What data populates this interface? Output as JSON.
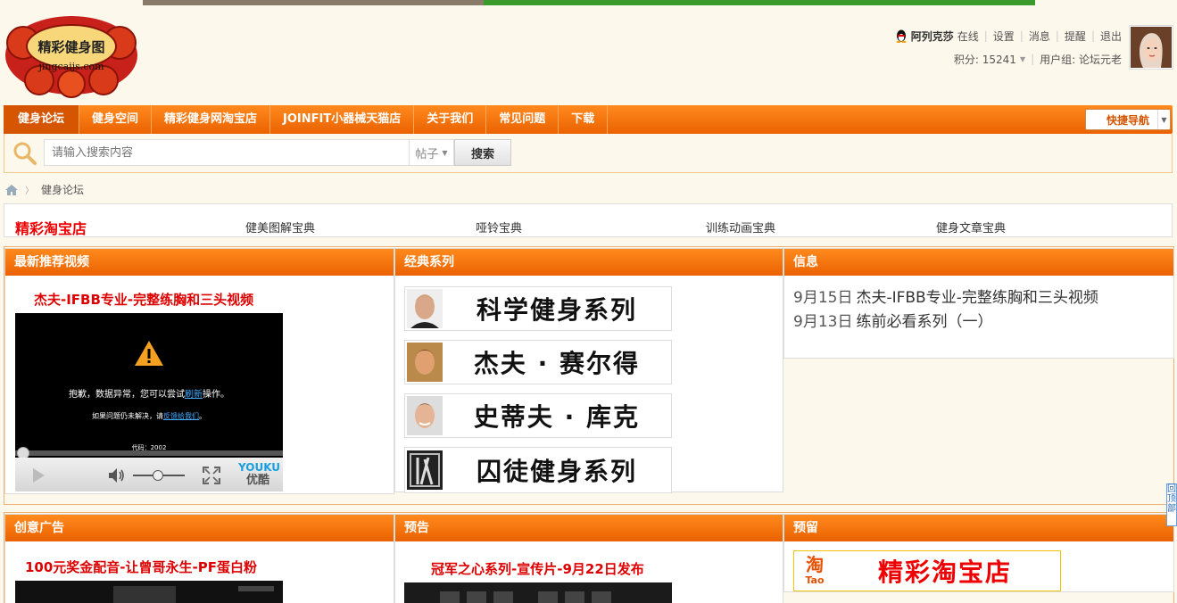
{
  "logo": {
    "site_text": "jingcaijs.com",
    "name_chars": "精彩健身图"
  },
  "user": {
    "name": "阿列克莎",
    "status": "在线",
    "links": [
      "设置",
      "消息",
      "提醒",
      "退出"
    ],
    "points_label": "积分: 15241",
    "group_label": "用户组: 论坛元老"
  },
  "nav": {
    "items": [
      "健身论坛",
      "健身空间",
      "精彩健身网淘宝店",
      "JOINFIT小器械天猫店",
      "关于我们",
      "常见问题",
      "下载"
    ],
    "quick_nav": "快捷导航"
  },
  "search": {
    "placeholder": "请输入搜索内容",
    "type": "帖子",
    "button": "搜索"
  },
  "breadcrumb": {
    "current": "健身论坛"
  },
  "links_row": {
    "shop": "精彩淘宝店",
    "items": [
      "健美图解宝典",
      "哑铃宝典",
      "训练动画宝典",
      "健身文章宝典"
    ]
  },
  "panels": {
    "video": {
      "head": "最新推荐视频",
      "title": "杰夫-IFBB专业-完整练胸和三头视频",
      "msg1_pre": "抱歉，数据异常，您可以尝试",
      "msg1_link": "刷新",
      "msg1_post": "操作。",
      "msg2_pre": "如果问题仍未解决，请",
      "msg2_link": "反馈给我们",
      "msg2_post": "。",
      "code": "代码：2002",
      "player_brand_en": "YOUKU",
      "player_brand_cn": "优酷"
    },
    "classic": {
      "head": "经典系列",
      "items": [
        "科学健身系列",
        "杰夫 · 赛尔得",
        "史蒂夫 · 库克",
        "囚徒健身系列"
      ]
    },
    "info": {
      "head": "信息",
      "items": [
        {
          "date": "9月15日",
          "text": "杰夫-IFBB专业-完整练胸和三头视频"
        },
        {
          "date": "9月13日",
          "text": "练前必看系列（一）"
        }
      ]
    },
    "creative": {
      "head": "创意广告",
      "title": "100元奖金配音-让曾哥永生-PF蛋白粉"
    },
    "preview": {
      "head": "预告",
      "title": "冠军之心系列-宣传片-9月22日发布"
    },
    "reserved": {
      "head": "预留",
      "banner_text": "精彩淘宝店",
      "taobao_big": "淘",
      "taobao_small": "Tao"
    }
  },
  "side_tab": "回顶部",
  "colors": {
    "accent": "#ea6200",
    "brand_red": "#dd0000"
  }
}
